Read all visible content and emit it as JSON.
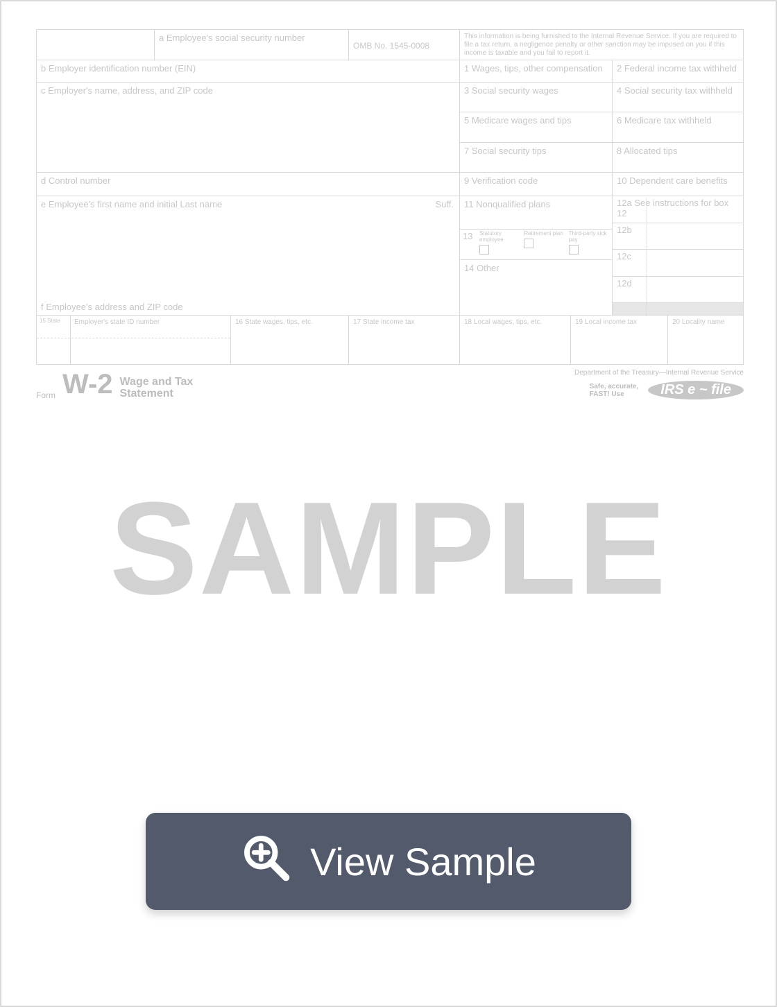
{
  "form": {
    "a_label": "a  Employee's social security number",
    "omb": "OMB No. 1545-0008",
    "info_text": "This information is being furnished to the Internal Revenue Service. If you are required to file a tax return, a negligence penalty or other sanction may be imposed on you if this income is taxable and you fail to report it.",
    "b_label": "b  Employer identification number (EIN)",
    "box1": "1   Wages, tips, other compensation",
    "box2": "2   Federal income tax withheld",
    "c_label": "c  Employer's name, address, and ZIP code",
    "box3": "3   Social security wages",
    "box4": "4   Social security tax withheld",
    "box5": "5   Medicare wages and tips",
    "box6": "6   Medicare tax withheld",
    "box7": "7   Social security tips",
    "box8": "8   Allocated tips",
    "d_label": "d  Control number",
    "box9": "9   Verification code",
    "box10": "10  Dependent care benefits",
    "e_label": "e  Employee's first name and initial      Last name",
    "suff": "Suff.",
    "box11": "11  Nonqualified plans",
    "box12a": "12a  See instructions for box 12",
    "box13": "13",
    "box13_stat": "Statutory employee",
    "box13_ret": "Retirement plan",
    "box13_sick": "Third-party sick pay",
    "box12b": "12b",
    "box14": "14  Other",
    "box12c": "12c",
    "box12d": "12d",
    "f_label": "f  Employee's address and ZIP code",
    "box15": "15  State",
    "box15b": "Employer's state ID number",
    "box16": "16  State wages, tips, etc.",
    "box17": "17  State income tax",
    "box18": "18  Local wages, tips, etc.",
    "box19": "19  Local income tax",
    "box20": "20  Locality name"
  },
  "footer": {
    "form_word": "Form",
    "w2": "W-2",
    "wage_line1": "Wage and Tax",
    "wage_line2": "Statement",
    "dept": "Department of the Treasury—Internal Revenue Service",
    "safe1": "Safe, accurate,",
    "safe2": "FAST!  Use",
    "efile": "IRS e ~ file"
  },
  "watermark": "SAMPLE",
  "button_label": "View Sample"
}
